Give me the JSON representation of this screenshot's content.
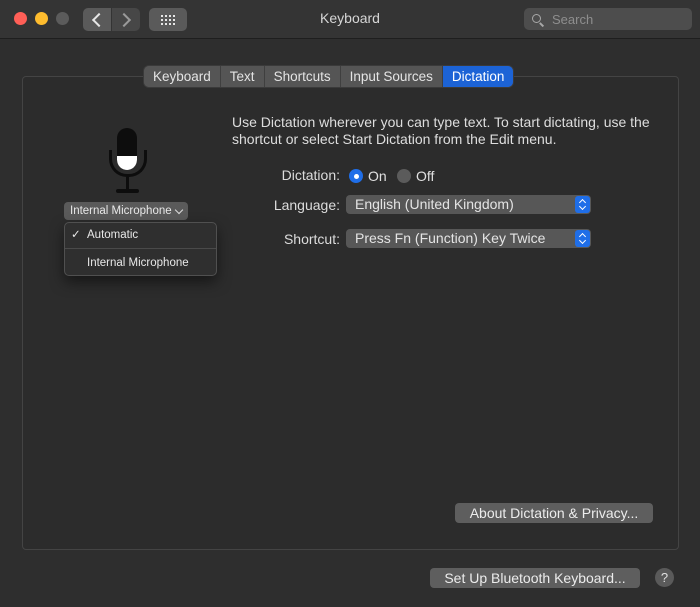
{
  "window": {
    "title": "Keyboard"
  },
  "search": {
    "placeholder": "Search"
  },
  "tabs": [
    {
      "label": "Keyboard"
    },
    {
      "label": "Text"
    },
    {
      "label": "Shortcuts"
    },
    {
      "label": "Input Sources"
    },
    {
      "label": "Dictation",
      "active": true
    }
  ],
  "microphone": {
    "selected": "Internal Microphone",
    "menu": [
      {
        "label": "Automatic",
        "checked": true
      },
      {
        "label": "Internal Microphone",
        "checked": false
      }
    ]
  },
  "description": "Use Dictation wherever you can type text. To start dictating, use the shortcut or select Start Dictation from the Edit menu.",
  "dictation": {
    "label": "Dictation:",
    "on_label": "On",
    "off_label": "Off",
    "value": "On"
  },
  "language": {
    "label": "Language:",
    "value": "English (United Kingdom)"
  },
  "shortcut": {
    "label": "Shortcut:",
    "value": "Press Fn (Function) Key Twice"
  },
  "buttons": {
    "about": "About Dictation & Privacy...",
    "bluetooth": "Set Up Bluetooth Keyboard...",
    "help": "?"
  },
  "colors": {
    "accent": "#1f6ee8",
    "close": "#ff5f57",
    "minimize": "#febc2e"
  }
}
